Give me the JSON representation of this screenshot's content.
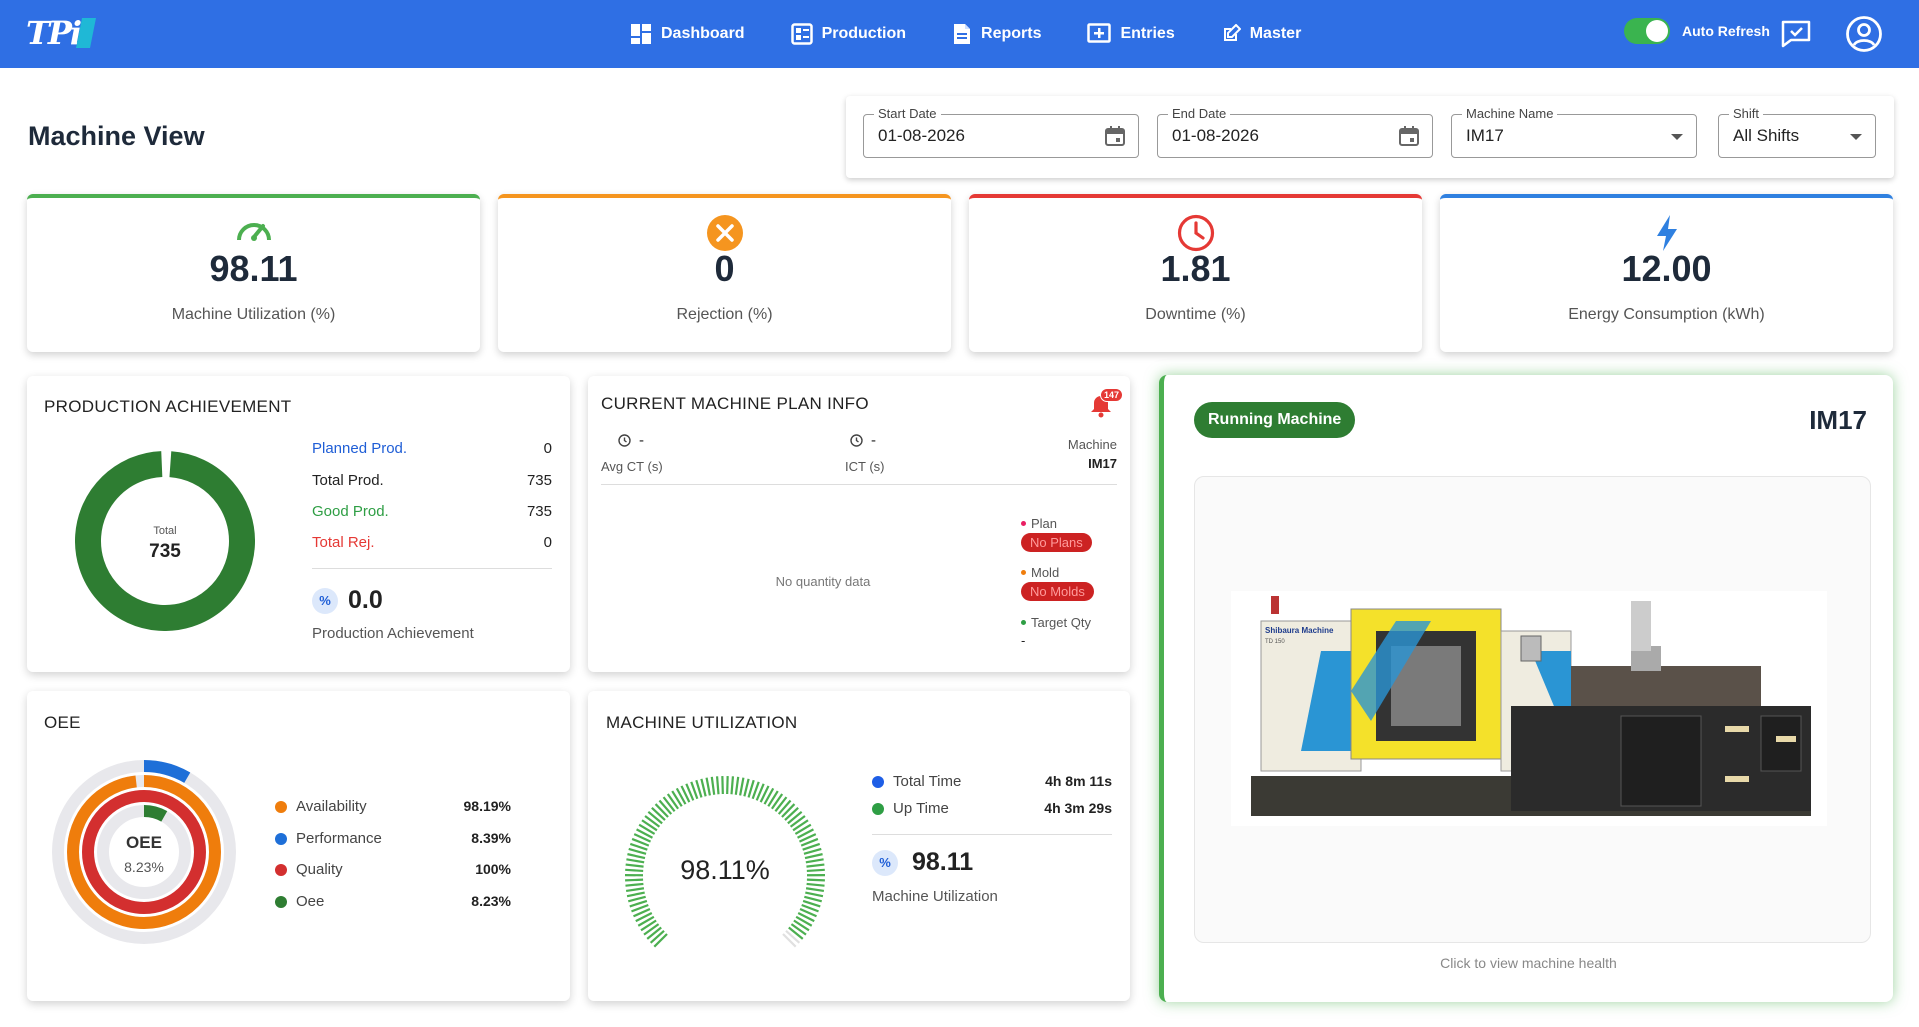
{
  "app": {
    "logo_text": "TPi"
  },
  "nav": {
    "items": [
      {
        "label": "Dashboard",
        "icon": "dashboard-icon"
      },
      {
        "label": "Production",
        "icon": "production-icon"
      },
      {
        "label": "Reports",
        "icon": "reports-icon"
      },
      {
        "label": "Entries",
        "icon": "entries-icon"
      },
      {
        "label": "Master",
        "icon": "master-icon"
      }
    ]
  },
  "header": {
    "auto_refresh_label": "Auto Refresh",
    "auto_refresh_on": true
  },
  "page": {
    "title": "Machine View"
  },
  "filters": {
    "start_date": {
      "label": "Start Date",
      "value": "01-08-2026"
    },
    "end_date": {
      "label": "End Date",
      "value": "01-08-2026"
    },
    "machine_name": {
      "label": "Machine Name",
      "value": "IM17"
    },
    "shift": {
      "label": "Shift",
      "value": "All Shifts"
    }
  },
  "kpis": [
    {
      "value": "98.11",
      "label": "Machine Utilization (%)",
      "color": "#4caf50",
      "icon": "speedometer-icon"
    },
    {
      "value": "0",
      "label": "Rejection (%)",
      "color": "#f5951f",
      "icon": "cancel-circle-icon"
    },
    {
      "value": "1.81",
      "label": "Downtime (%)",
      "color": "#e53935",
      "icon": "clock-icon"
    },
    {
      "value": "12.00",
      "label": "Energy Consumption (kWh)",
      "color": "#2f80e0",
      "icon": "lightning-icon"
    }
  ],
  "production": {
    "title": "PRODUCTION ACHIEVEMENT",
    "donut_center_label": "Total",
    "donut_center_value": "735",
    "rows": [
      {
        "label": "Planned Prod.",
        "value": "0",
        "color": "#1f5ed6"
      },
      {
        "label": "Total Prod.",
        "value": "735",
        "color": "#222222"
      },
      {
        "label": "Good Prod.",
        "value": "735",
        "color": "#2e9e44"
      },
      {
        "label": "Total Rej.",
        "value": "0",
        "color": "#e53935"
      }
    ],
    "pct_symbol": "%",
    "achievement_value": "0.0",
    "achievement_label": "Production Achievement"
  },
  "plan": {
    "title": "CURRENT MACHINE PLAN INFO",
    "notification_count": "147",
    "avg_ct_value": "-",
    "avg_ct_label": "Avg CT (s)",
    "ict_value": "-",
    "ict_label": "ICT (s)",
    "machine_label": "Machine",
    "machine_value": "IM17",
    "no_data": "No quantity data",
    "plan_label": "Plan",
    "plan_pill": "No Plans",
    "mold_label": "Mold",
    "mold_pill": "No Molds",
    "target_label": "Target Qty",
    "target_value": "-"
  },
  "oee": {
    "title": "OEE",
    "center_label": "OEE",
    "center_value": "8.23%",
    "rows": [
      {
        "label": "Availability",
        "value": "98.19%",
        "color": "#ef7d0c",
        "fraction": 0.9819
      },
      {
        "label": "Performance",
        "value": "8.39%",
        "color": "#1e6fd8",
        "fraction": 0.0839
      },
      {
        "label": "Quality",
        "value": "100%",
        "color": "#d32f2f",
        "fraction": 1.0
      },
      {
        "label": "Oee",
        "value": "8.23%",
        "color": "#2e7d32",
        "fraction": 0.0823
      }
    ]
  },
  "utilization": {
    "title": "MACHINE UTILIZATION",
    "gauge_value": "98.11%",
    "gauge_fraction": 0.9811,
    "total_time_label": "Total Time",
    "total_time_value": "4h 8m 11s",
    "up_time_label": "Up Time",
    "up_time_value": "4h 3m 29s",
    "pct_symbol": "%",
    "value": "98.11",
    "label": "Machine Utilization"
  },
  "machine": {
    "status": "Running Machine",
    "name": "IM17",
    "brand_text": "Shibaura Machine",
    "model_text": "TD 150",
    "hint": "Click to view machine health"
  }
}
